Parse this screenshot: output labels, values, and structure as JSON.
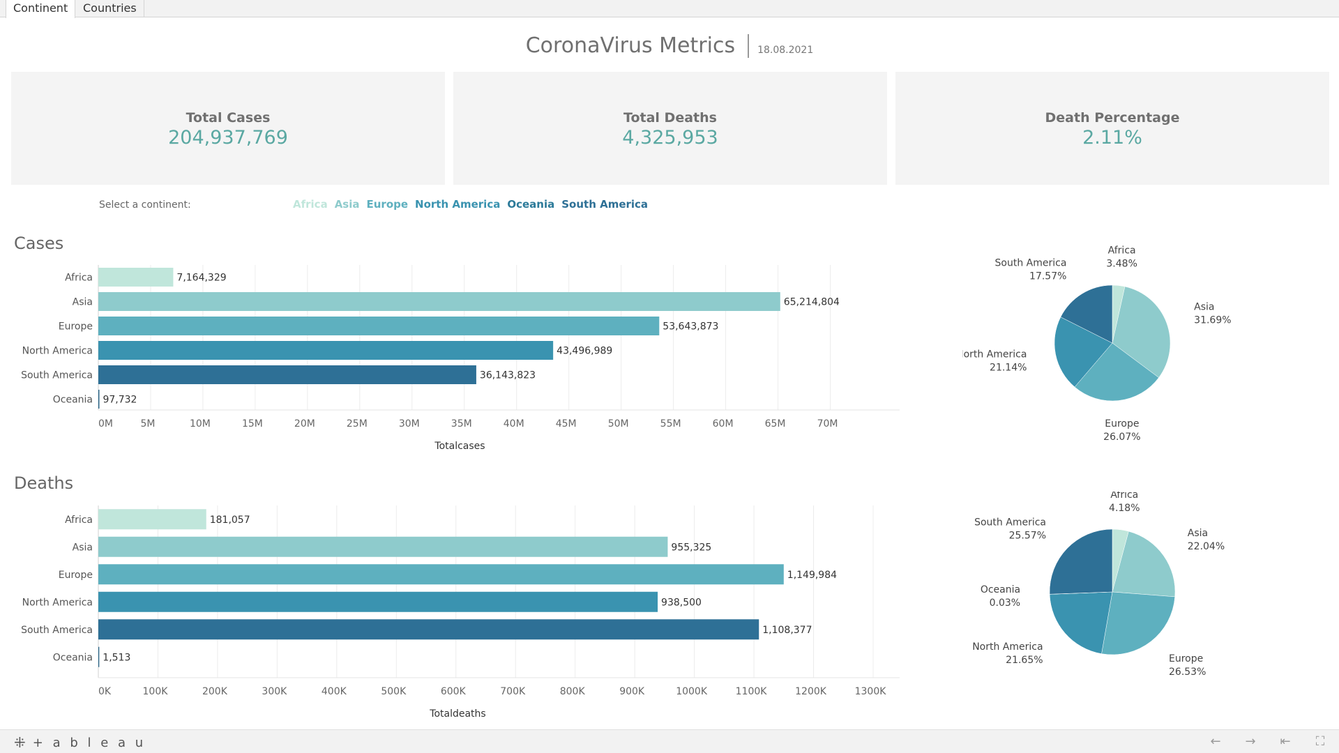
{
  "tabs": [
    {
      "label": "Continent",
      "active": true
    },
    {
      "label": "Countries",
      "active": false
    }
  ],
  "header": {
    "title": "CoronaVirus Metrics",
    "date": "18.08.2021"
  },
  "kpis": [
    {
      "label": "Total Cases",
      "value": "204,937,769"
    },
    {
      "label": "Total Deaths",
      "value": "4,325,953"
    },
    {
      "label": "Death Percentage",
      "value": "2.11%"
    }
  ],
  "filter": {
    "label": "Select a continent:",
    "options": [
      {
        "label": "Africa",
        "color": "#c0e6db"
      },
      {
        "label": "Asia",
        "color": "#8ecbcc"
      },
      {
        "label": "Europe",
        "color": "#5eb0bf"
      },
      {
        "label": "North America",
        "color": "#3a93b0"
      },
      {
        "label": "Oceania",
        "color": "#2c7a99"
      },
      {
        "label": "South America",
        "color": "#2e7096"
      }
    ]
  },
  "sections": {
    "cases": "Cases",
    "deaths": "Deaths"
  },
  "colors": {
    "Africa": "#c0e6db",
    "Asia": "#8ecbcc",
    "Europe": "#5eb0bf",
    "North America": "#3a93b0",
    "South America": "#2e7096",
    "Oceania": "#2a6587"
  },
  "chart_data": [
    {
      "type": "bar",
      "orientation": "horizontal",
      "categories": [
        "Africa",
        "Asia",
        "Europe",
        "North America",
        "South America",
        "Oceania"
      ],
      "values": [
        7164329,
        65214804,
        53643873,
        43496989,
        36143823,
        97732
      ],
      "labels": [
        "7,164,329",
        "65,214,804",
        "53,643,873",
        "43,496,989",
        "36,143,823",
        "97,732"
      ],
      "xlabel": "Totalcases",
      "xlim": [
        0,
        74500000
      ],
      "ticks": [
        0,
        5000000,
        10000000,
        15000000,
        20000000,
        25000000,
        30000000,
        35000000,
        40000000,
        45000000,
        50000000,
        55000000,
        60000000,
        65000000,
        70000000
      ],
      "tick_labels": [
        "0M",
        "5M",
        "10M",
        "15M",
        "20M",
        "25M",
        "30M",
        "35M",
        "40M",
        "45M",
        "50M",
        "55M",
        "60M",
        "65M",
        "70M"
      ],
      "grid": true
    },
    {
      "type": "pie",
      "slices": [
        {
          "name": "Africa",
          "percent": 3.48,
          "label": "3.48%"
        },
        {
          "name": "Asia",
          "percent": 31.69,
          "label": "31.69%"
        },
        {
          "name": "Europe",
          "percent": 26.07,
          "label": "26.07%"
        },
        {
          "name": "North America",
          "percent": 21.14,
          "label": "21.14%"
        },
        {
          "name": "South America",
          "percent": 17.57,
          "label": "17.57%"
        }
      ]
    },
    {
      "type": "bar",
      "orientation": "horizontal",
      "categories": [
        "Africa",
        "Asia",
        "Europe",
        "North America",
        "South America",
        "Oceania"
      ],
      "values": [
        181057,
        955325,
        1149984,
        938500,
        1108377,
        1513
      ],
      "labels": [
        "181,057",
        "955,325",
        "1,149,984",
        "938,500",
        "1,108,377",
        "1,513"
      ],
      "xlabel": "Totaldeaths",
      "xlim": [
        0,
        1300000
      ],
      "ticks": [
        0,
        100000,
        200000,
        300000,
        400000,
        500000,
        600000,
        700000,
        800000,
        900000,
        1000000,
        1100000,
        1200000,
        1300000
      ],
      "tick_labels": [
        "0K",
        "100K",
        "200K",
        "300K",
        "400K",
        "500K",
        "600K",
        "700K",
        "800K",
        "900K",
        "1000K",
        "1100K",
        "1200K",
        "1300K"
      ],
      "grid": true
    },
    {
      "type": "pie",
      "slices": [
        {
          "name": "Africa",
          "percent": 4.18,
          "label": "4.18%"
        },
        {
          "name": "Asia",
          "percent": 22.04,
          "label": "22.04%"
        },
        {
          "name": "Europe",
          "percent": 26.53,
          "label": "26.53%"
        },
        {
          "name": "North America",
          "percent": 21.65,
          "label": "21.65%"
        },
        {
          "name": "Oceania",
          "percent": 0.03,
          "label": "0.03%"
        },
        {
          "name": "South America",
          "percent": 25.57,
          "label": "25.57%"
        }
      ]
    }
  ],
  "footer": {
    "brand": "+ a b l e a u"
  }
}
